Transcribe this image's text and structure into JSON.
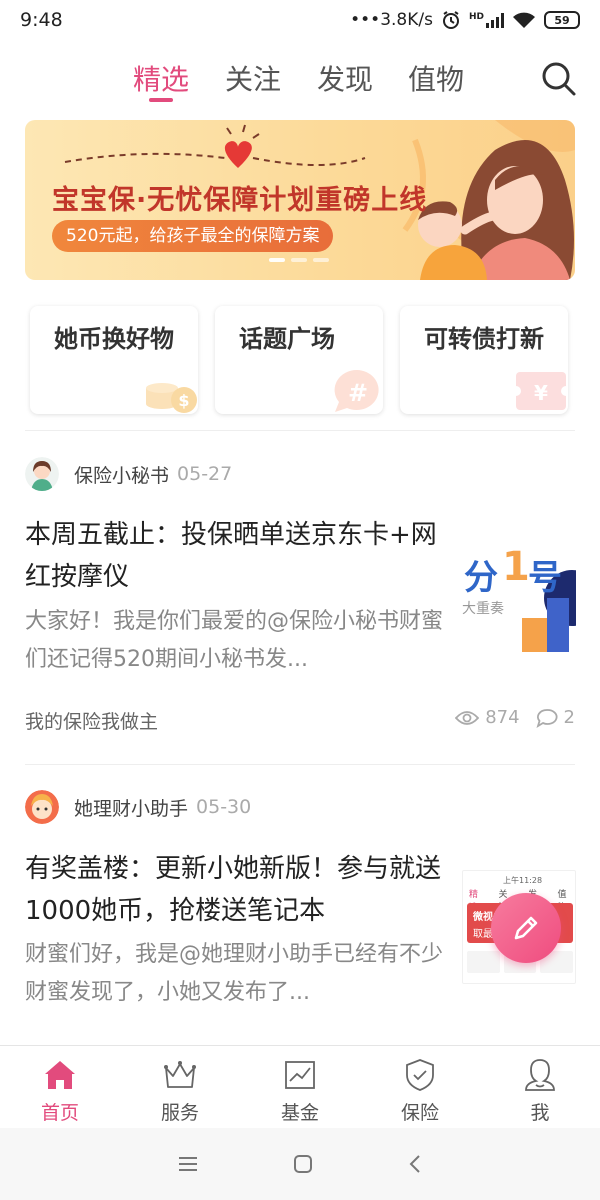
{
  "status_bar": {
    "time": "9:48",
    "net_speed": "•••3.8K/s",
    "hd": "HD",
    "battery": "59"
  },
  "top_tabs": [
    {
      "label": "精选",
      "active": true
    },
    {
      "label": "关注",
      "active": false
    },
    {
      "label": "发现",
      "active": false
    },
    {
      "label": "值物",
      "active": false
    }
  ],
  "accent_color": "#e24b7d",
  "banner": {
    "title": "宝宝保·无忧保障计划重磅上线",
    "subtitle": "520元起，给孩子最全的保障方案",
    "page_count": 3,
    "active_page": 1
  },
  "shortcuts": [
    {
      "label": "她币换好物",
      "icon": "coin-icon"
    },
    {
      "label": "话题广场",
      "icon": "hashtag-bubble-icon"
    },
    {
      "label": "可转债打新",
      "icon": "yen-ticket-icon"
    }
  ],
  "posts": [
    {
      "author": "保险小秘书",
      "date": "05-27",
      "title": "本周五截止：投保晒单送京东卡+网红按摩仪",
      "body": "大家好！我是你们最爱的@保险小秘书财蜜们还记得520期间小秘书发...",
      "topic": "我的保险我做主",
      "views": "874",
      "comments": "2",
      "thumb_text_1": "分",
      "thumb_text_2": "1",
      "thumb_text_3": "号",
      "thumb_caption": "大重奏"
    },
    {
      "author": "她理财小助手",
      "date": "05-30",
      "title": "有奖盖楼：更新小她新版！参与就送1000她币，抢楼送笔记本",
      "body": "财蜜们好，我是@她理财小助手已经有不少财蜜发现了，小她又发布了...",
      "thumb_tabs": [
        "精选",
        "关注",
        "发现",
        "值物"
      ],
      "thumb_banner": "微视关注小她",
      "thumb_banner2": "取最高1%",
      "thumb_time": "上午11:28"
    }
  ],
  "bottom_nav": [
    {
      "label": "首页",
      "icon": "home-icon",
      "active": true
    },
    {
      "label": "服务",
      "icon": "crown-icon",
      "active": false
    },
    {
      "label": "基金",
      "icon": "chart-icon",
      "active": false
    },
    {
      "label": "保险",
      "icon": "shield-icon",
      "active": false
    },
    {
      "label": "我",
      "icon": "user-icon",
      "active": false
    }
  ]
}
